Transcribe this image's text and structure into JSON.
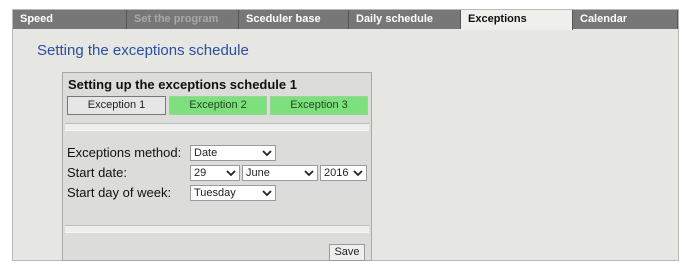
{
  "tabs": [
    {
      "label": "Speed",
      "state": "normal"
    },
    {
      "label": "Set the program",
      "state": "disabled"
    },
    {
      "label": "Sceduler base",
      "state": "normal"
    },
    {
      "label": "Daily schedule",
      "state": "normal"
    },
    {
      "label": "Exceptions",
      "state": "active"
    },
    {
      "label": "Calendar",
      "state": "normal"
    }
  ],
  "page": {
    "title": "Setting the exceptions schedule"
  },
  "panel": {
    "title": "Setting up the exceptions schedule 1",
    "subtabs": [
      {
        "label": "Exception 1"
      },
      {
        "label": "Exception 2"
      },
      {
        "label": "Exception 3"
      }
    ],
    "method": {
      "label": "Exceptions method:",
      "value": "Date"
    },
    "start_date": {
      "label": "Start date:",
      "day": "29",
      "month": "June",
      "year": "2016"
    },
    "start_day": {
      "label": "Start day of week:",
      "value": "Tuesday"
    },
    "save_label": "Save"
  },
  "colors": {
    "title_blue": "#2c4ea1",
    "tab_bar": "#5f5f5f",
    "subtab_green": "#7de07d"
  }
}
